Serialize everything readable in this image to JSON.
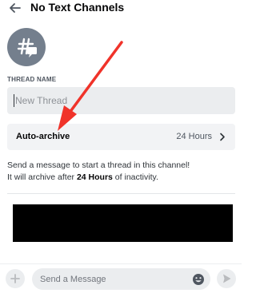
{
  "header": {
    "back_icon": "arrow-left-icon",
    "title": "No Text Channels"
  },
  "thread_avatar": {
    "icon": "thread-hashtag-icon",
    "background": "#747f8d"
  },
  "thread_name": {
    "label": "THREAD NAME",
    "placeholder": "New Thread",
    "value": ""
  },
  "auto_archive": {
    "label": "Auto-archive",
    "value": "24 Hours",
    "icon": "chevron-right-icon"
  },
  "info": {
    "line1": "Send a message to start a thread in this channel!",
    "line2_prefix": "It will archive after ",
    "line2_bold": "24 Hours",
    "line2_suffix": " of inactivity."
  },
  "composer": {
    "plus_icon": "plus-icon",
    "placeholder": "Send a Message",
    "emoji_icon": "emoji-icon",
    "send_icon": "send-icon"
  },
  "colors": {
    "annotation_arrow": "#f0332a",
    "input_background": "#ebedef"
  }
}
